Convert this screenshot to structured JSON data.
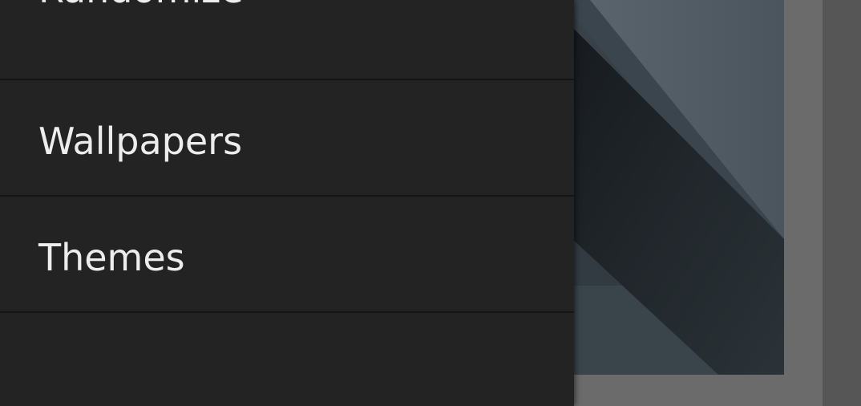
{
  "drawer": {
    "items": [
      {
        "label": "Randomize"
      },
      {
        "label": "Wallpapers"
      },
      {
        "label": "Themes"
      }
    ]
  },
  "colors": {
    "drawer_bg": "#232323",
    "divider": "#151515",
    "text": "#ededed",
    "wallpaper_light": "#4e5861",
    "wallpaper_dark": "#1c2125"
  }
}
